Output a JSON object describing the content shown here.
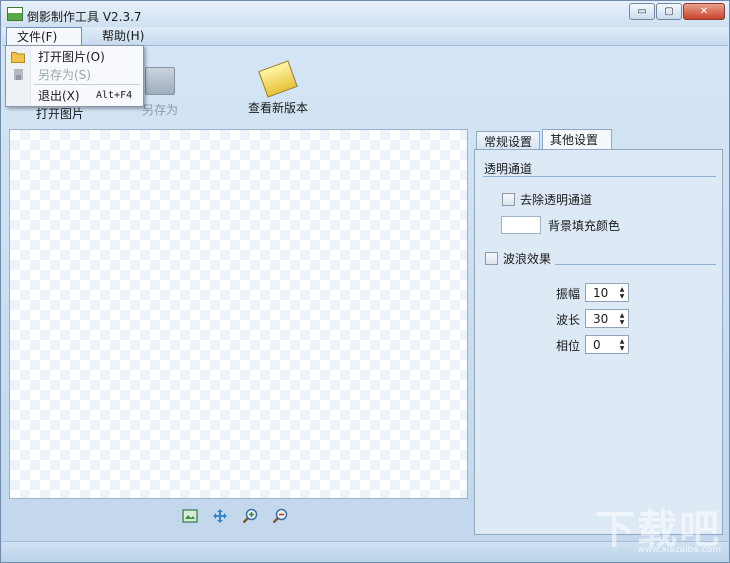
{
  "window": {
    "title": "倒影制作工具 V2.3.7",
    "controls": {
      "minimize": "▭",
      "maximize": "▢",
      "close": "✕"
    }
  },
  "menubar": {
    "file": "文件(F)",
    "help": "帮助(H)"
  },
  "file_menu": {
    "items": [
      {
        "label": "打开图片(O)",
        "shortcut": "",
        "icon": "folder-icon",
        "enabled": true
      },
      {
        "label": "另存为(S)",
        "shortcut": "",
        "icon": "save-icon",
        "enabled": false
      },
      {
        "label": "退出(X)",
        "shortcut": "Alt+F4",
        "icon": "",
        "enabled": true
      }
    ]
  },
  "toolbar": {
    "open_label": "打开图片",
    "saveas_label": "另存为",
    "update_label": "查看新版本"
  },
  "tabs": {
    "general": "常规设置",
    "other": "其他设置"
  },
  "panel": {
    "transparency_title": "透明通道",
    "remove_alpha_label": "去除透明通道",
    "bg_fill_label": "背景填充颜色",
    "wave_title": "波浪效果",
    "amplitude_label": "振幅",
    "amplitude_value": "10",
    "wavelength_label": "波长",
    "wavelength_value": "30",
    "phase_label": "相位",
    "phase_value": "0"
  },
  "watermark": {
    "text": "下载吧",
    "url": "www.xiazaiba.com"
  },
  "colors": {
    "accent": "#6e92bd",
    "panel_bg": "#dde9f5",
    "checker_light": "#edf3f9"
  }
}
